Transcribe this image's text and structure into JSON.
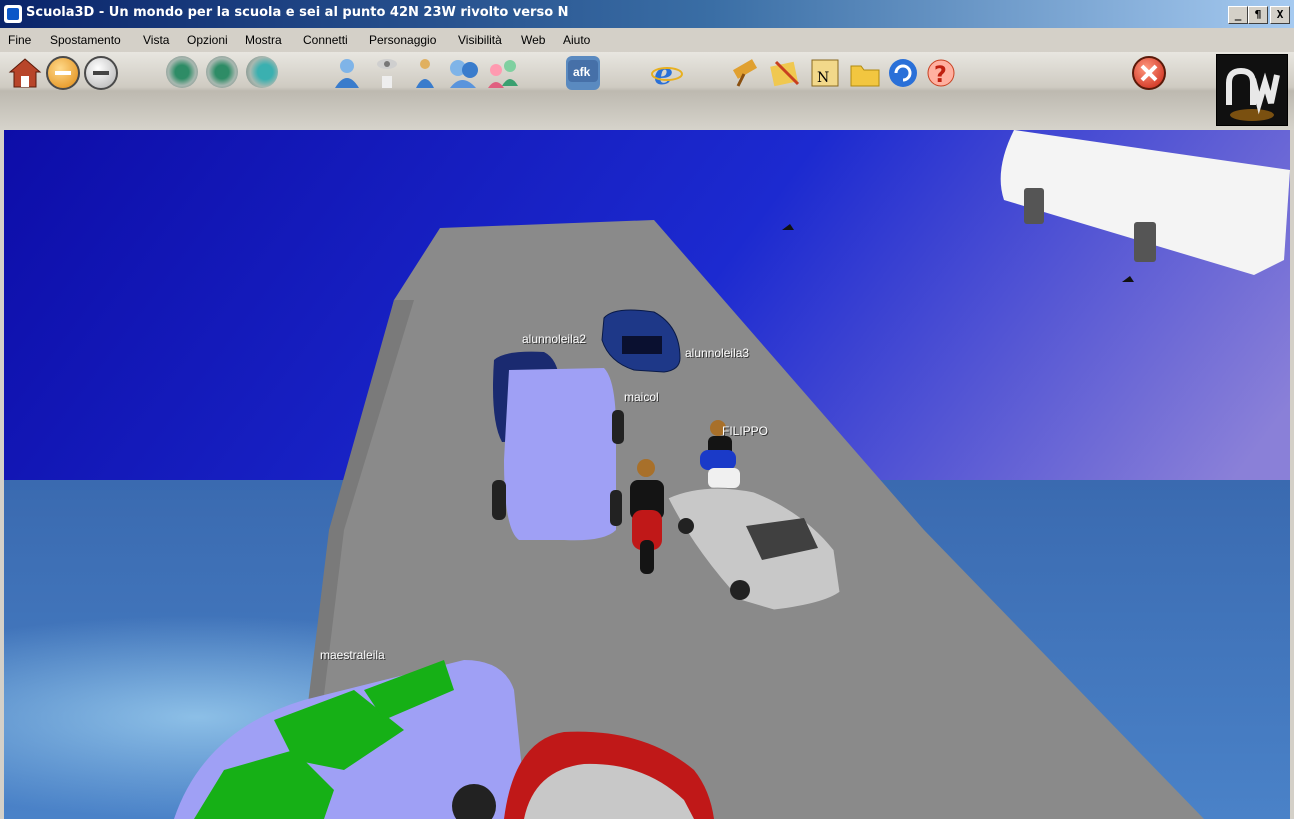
{
  "window": {
    "title": "Scuola3D - Un mondo per la scuola e sei al punto 42N 23W rivolto verso N",
    "controls": {
      "minimize": "_",
      "restore": "¶",
      "close": "X"
    }
  },
  "menu": [
    "Fine",
    "Spostamento",
    "Vista",
    "Opzioni",
    "Mostra",
    "Connetti",
    "Personaggio",
    "Visibilità",
    "Web",
    "Aiuto"
  ],
  "toolbar_icons": [
    "home-icon",
    "back-icon",
    "forward-icon",
    "view-eye-icon",
    "view-eye-alt-icon",
    "view-eye-side-icon",
    "avatar-icon",
    "avatar-ghost-icon",
    "avatar-small-icon",
    "users-group-icon",
    "users-chat-icon",
    "afk-icon",
    "internet-explorer-icon",
    "telescope-icon",
    "notes-icon",
    "map-icon",
    "folder-icon",
    "refresh-icon",
    "help-icon",
    "close-icon",
    "logo"
  ],
  "toolbar_afk_text": "afk",
  "map_text": "N",
  "scene_labels": {
    "a2": "alunnoleila2",
    "a3": "alunnoleila3",
    "maicol": "maicol",
    "filippo": "FILIPPO",
    "maestra": "maestraleila"
  },
  "colors": {
    "sky": "#1818b8",
    "sea": "#2a5c9e",
    "road": "#8c8c8c",
    "lilac_car": "#9fa0f5",
    "red_car": "#c01818",
    "green": "#16b016"
  }
}
